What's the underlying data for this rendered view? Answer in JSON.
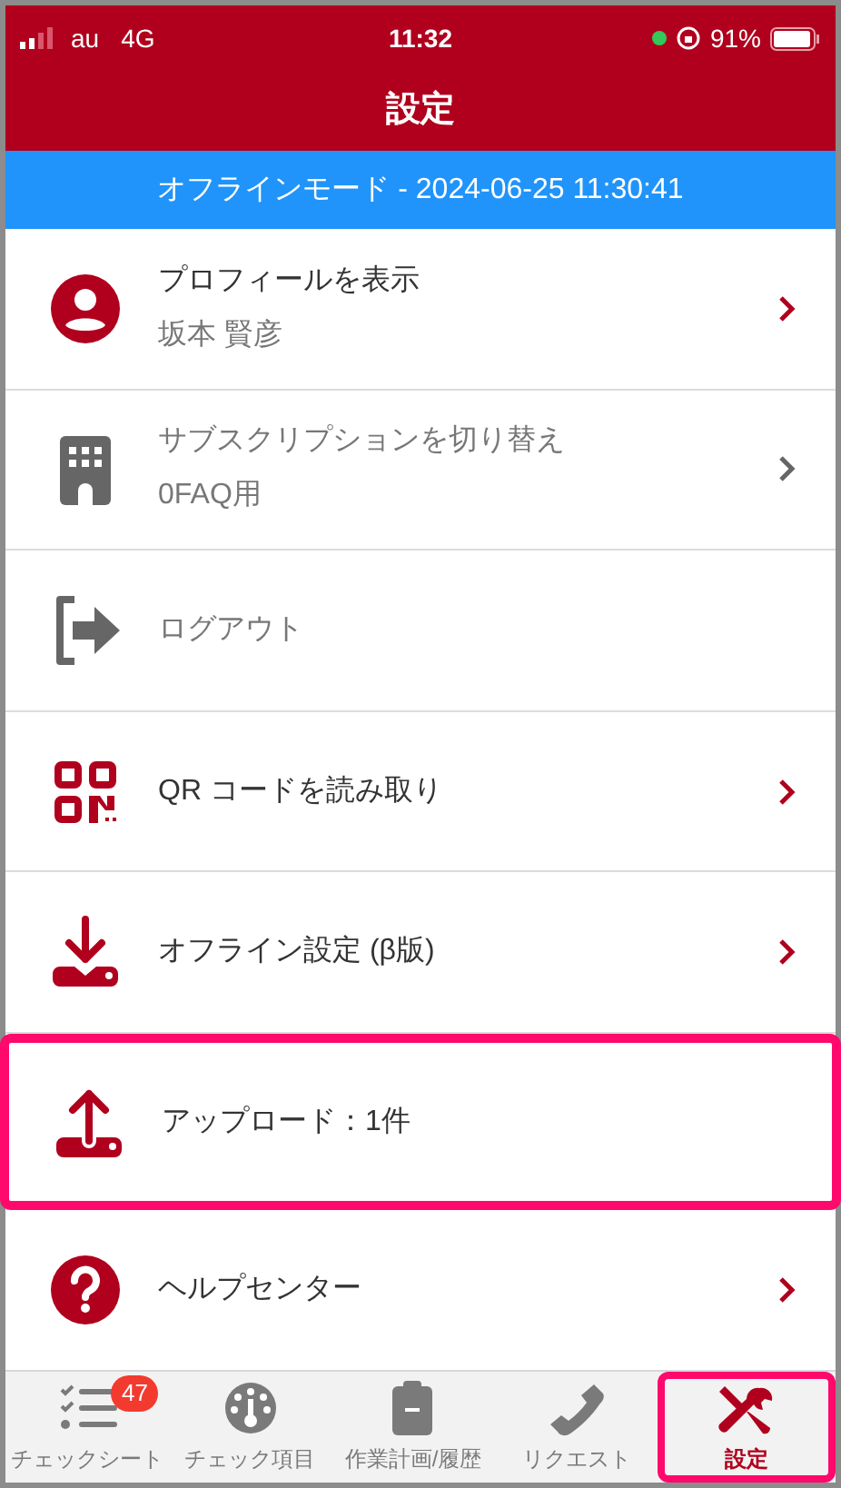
{
  "status_bar": {
    "carrier": "au",
    "network": "4G",
    "time": "11:32",
    "battery": "91%"
  },
  "title": "設定",
  "offline_banner": "オフラインモード - 2024-06-25 11:30:41",
  "menu": [
    {
      "kind": "profile",
      "title": "プロフィールを表示",
      "subtitle": "坂本 賢彦",
      "disabled": false,
      "chevron": true,
      "highlighted": false
    },
    {
      "kind": "building",
      "title": "サブスクリプションを切り替え",
      "subtitle": "0FAQ用",
      "disabled": true,
      "chevron": true,
      "highlighted": false
    },
    {
      "kind": "logout",
      "title": "ログアウト",
      "disabled": true,
      "chevron": false,
      "highlighted": false
    },
    {
      "kind": "qr",
      "title": "QR コードを読み取り",
      "disabled": false,
      "chevron": true,
      "highlighted": false
    },
    {
      "kind": "download",
      "title": "オフライン設定 (β版)",
      "disabled": false,
      "chevron": true,
      "highlighted": false
    },
    {
      "kind": "upload",
      "title": "アップロード：1件",
      "disabled": false,
      "chevron": false,
      "highlighted": true
    },
    {
      "kind": "help",
      "title": "ヘルプセンター",
      "disabled": false,
      "chevron": true,
      "highlighted": false
    }
  ],
  "tabs": [
    {
      "kind": "checklist",
      "label": "チェックシート",
      "badge": "47",
      "selected": false
    },
    {
      "kind": "gauge",
      "label": "チェック項目",
      "selected": false
    },
    {
      "kind": "clipboard",
      "label": "作業計画/履歴",
      "selected": false
    },
    {
      "kind": "phone",
      "label": "リクエスト",
      "selected": false
    },
    {
      "kind": "tools",
      "label": "設定",
      "selected": true
    }
  ]
}
